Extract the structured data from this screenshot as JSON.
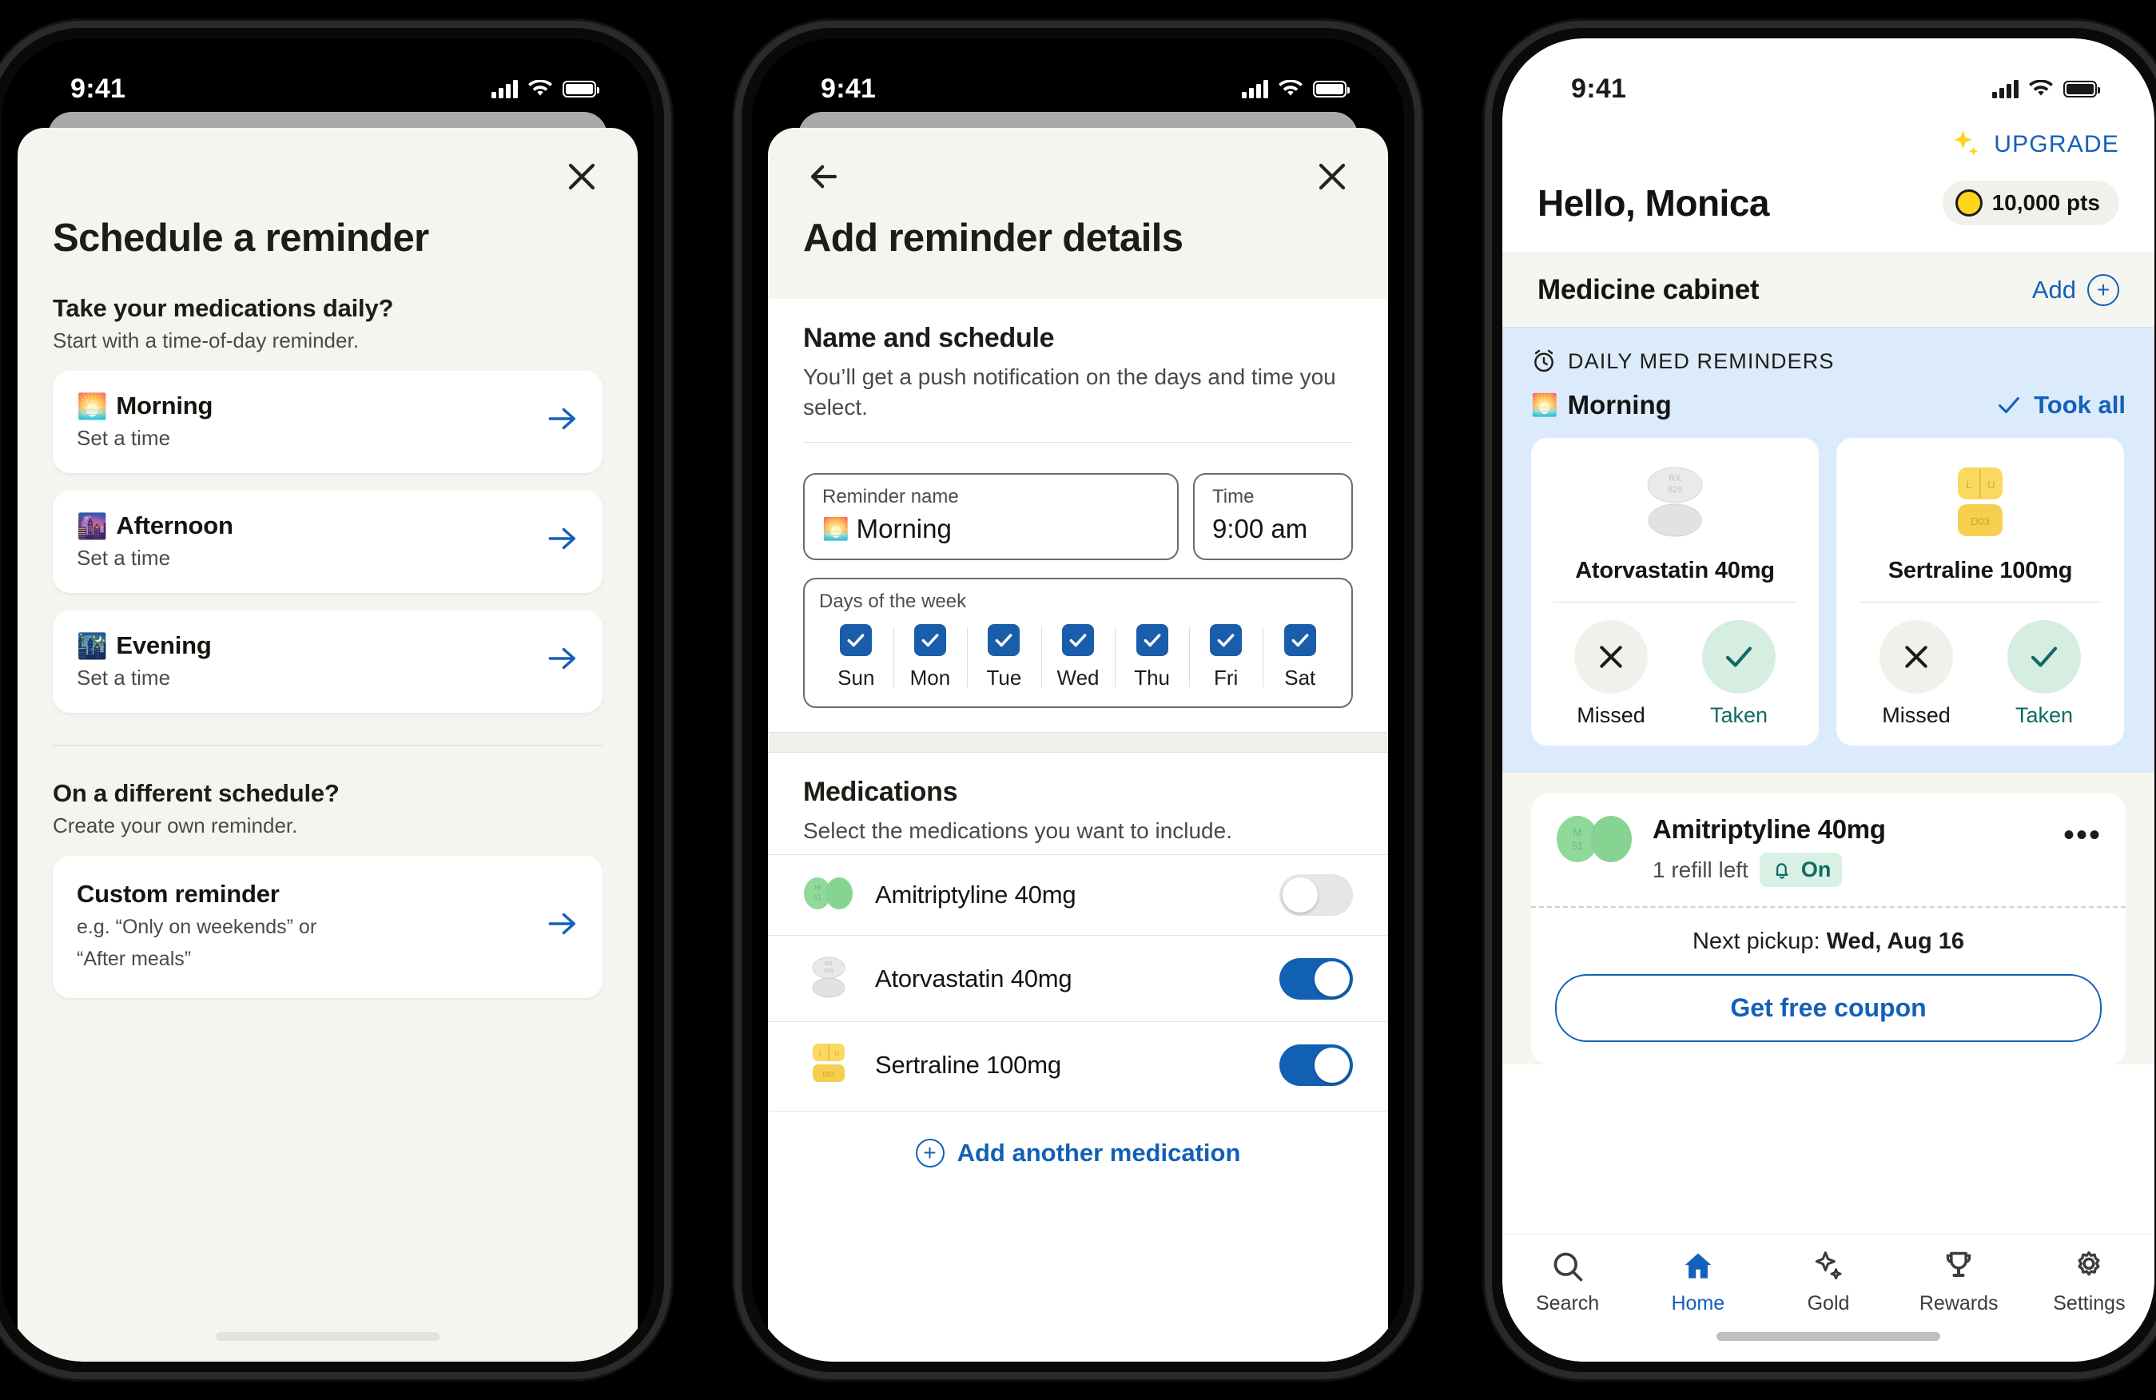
{
  "status_bar": {
    "time": "9:41"
  },
  "phone1": {
    "title": "Schedule a reminder",
    "close_label": "close-icon",
    "section1": {
      "heading": "Take your medications daily?",
      "subheading": "Start with a time-of-day reminder.",
      "options": [
        {
          "emoji": "🌅",
          "title": "Morning",
          "sub": "Set a time"
        },
        {
          "emoji": "🌆",
          "title": "Afternoon",
          "sub": "Set a time"
        },
        {
          "emoji": "🌃",
          "title": "Evening",
          "sub": "Set a time"
        }
      ]
    },
    "section2": {
      "heading": "On a different schedule?",
      "subheading": "Create your own reminder.",
      "custom": {
        "title": "Custom reminder",
        "sub_line1": "e.g. “Only on weekends” or",
        "sub_line2": "“After meals”"
      }
    }
  },
  "phone2": {
    "title": "Add reminder details",
    "back_label": "back-arrow-icon",
    "close_label": "close-icon",
    "name_schedule": {
      "heading": "Name and schedule",
      "subheading": "You’ll get a push notification on the days and time you select.",
      "reminder_name_label": "Reminder name",
      "reminder_name_emoji": "🌅",
      "reminder_name_value": "Morning",
      "time_label": "Time",
      "time_value": "9:00 am",
      "days_label": "Days of the week",
      "days": [
        {
          "label": "Sun",
          "checked": true
        },
        {
          "label": "Mon",
          "checked": true
        },
        {
          "label": "Tue",
          "checked": true
        },
        {
          "label": "Wed",
          "checked": true
        },
        {
          "label": "Thu",
          "checked": true
        },
        {
          "label": "Fri",
          "checked": true
        },
        {
          "label": "Sat",
          "checked": true
        }
      ]
    },
    "medications": {
      "heading": "Medications",
      "subheading": "Select the medications you want to include.",
      "items": [
        {
          "name": "Amitriptyline 40mg",
          "pill": "green-oval-pair",
          "on": false
        },
        {
          "name": "Atorvastatin 40mg",
          "pill": "white-oval-pair",
          "on": true
        },
        {
          "name": "Sertraline 100mg",
          "pill": "yellow-capsule-pair",
          "on": true
        }
      ],
      "add_another": "Add another medication"
    }
  },
  "phone3": {
    "upgrade_label": "UPGRADE",
    "greeting": "Hello, Monica",
    "points": "10,000 pts",
    "cabinet": {
      "title": "Medicine cabinet",
      "add_label": "Add"
    },
    "reminders": {
      "section_label": "DAILY MED REMINDERS",
      "group_emoji": "🌅",
      "group_title": "Morning",
      "took_all_label": "Took all",
      "cards": [
        {
          "name": "Atorvastatin 40mg",
          "pill": "white-oval",
          "imprint_top": "RX",
          "imprint_bottom": "829",
          "missed_label": "Missed",
          "taken_label": "Taken"
        },
        {
          "name": "Sertraline 100mg",
          "pill": "yellow-capsule",
          "imprint_top": "L U",
          "imprint_bottom": "D03",
          "missed_label": "Missed",
          "taken_label": "Taken"
        }
      ]
    },
    "med_detail": {
      "name": "Amitriptyline 40mg",
      "refill": "1 refill left",
      "reminder_state": "On",
      "pickup_prefix": "Next pickup:",
      "pickup_date": "Wed, Aug 16",
      "coupon_label": "Get free coupon",
      "menu_label": "more-options"
    },
    "tabs": [
      {
        "label": "Search",
        "icon": "search-icon",
        "active": false
      },
      {
        "label": "Home",
        "icon": "home-icon",
        "active": true
      },
      {
        "label": "Gold",
        "icon": "sparkle-icon",
        "active": false
      },
      {
        "label": "Rewards",
        "icon": "trophy-icon",
        "active": false
      },
      {
        "label": "Settings",
        "icon": "gear-icon",
        "active": false
      }
    ]
  },
  "colors": {
    "accent_blue": "#1460ba",
    "teal": "#0f6b63",
    "gold": "#ffd41d",
    "reminder_bg": "#dcebfb",
    "sheet_bg": "#f5f5f0"
  }
}
